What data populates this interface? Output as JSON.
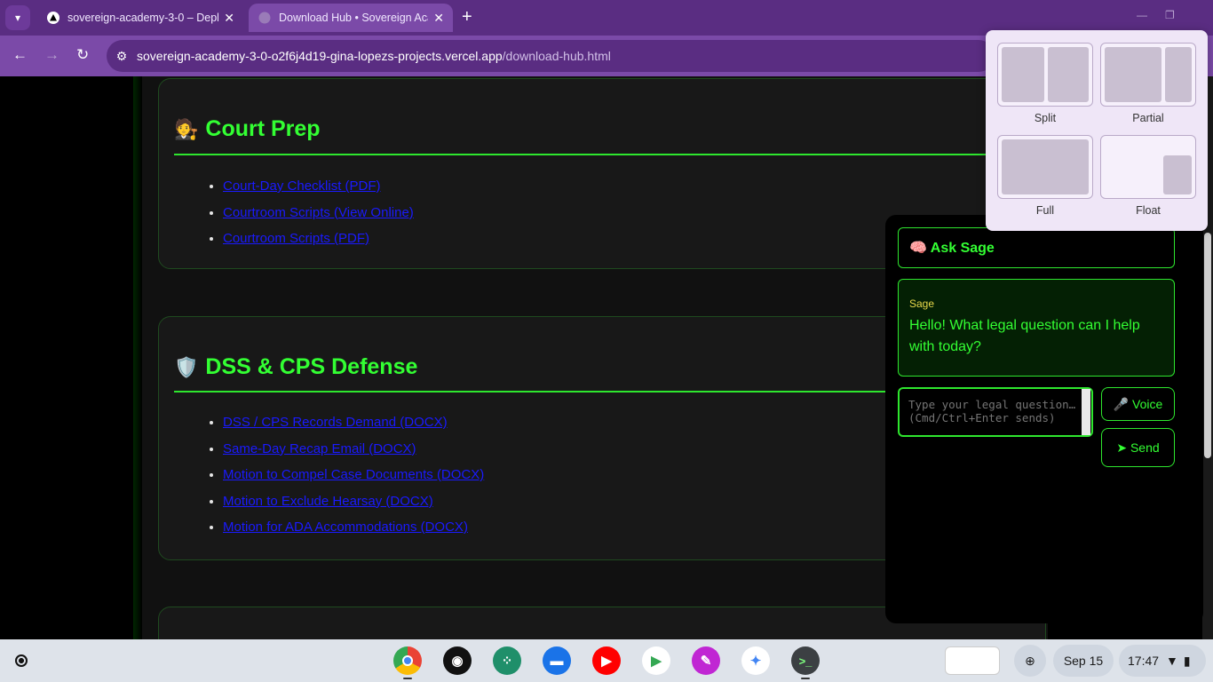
{
  "browser": {
    "tabs": [
      {
        "title": "sovereign-academy-3-0 – Deplo",
        "favicon": "vercel-icon"
      },
      {
        "title": "Download Hub • Sovereign Aca",
        "favicon": "globe-icon"
      }
    ],
    "url_host": "sovereign-academy-3-0-o2f6j4d19-gina-lopezs-projects.vercel.app",
    "url_path": "/download-hub.html"
  },
  "sections": [
    {
      "emoji": "🧑‍⚖️",
      "title": "Court Prep",
      "links": [
        "Court-Day Checklist (PDF)",
        "Courtroom Scripts (View Online)",
        "Courtroom Scripts (PDF)"
      ]
    },
    {
      "emoji": "🛡️",
      "title": "DSS & CPS Defense",
      "links": [
        "DSS / CPS Records Demand (DOCX)",
        "Same-Day Recap Email (DOCX)",
        "Motion to Compel Case Documents (DOCX)",
        "Motion to Exclude Hearsay (DOCX)",
        "Motion for ADA Accommodations (DOCX)"
      ]
    }
  ],
  "sage": {
    "title": "🧠 Ask Sage",
    "sender": "Sage",
    "message": "Hello! What legal question can I help with today?",
    "input_placeholder": "Type your legal question… (Cmd/Ctrl+Enter sends)",
    "voice_label": "🎤 Voice",
    "send_label": "➤ Send"
  },
  "snap_layout": {
    "options": [
      "Split",
      "Partial",
      "Full",
      "Float"
    ]
  },
  "shelf": {
    "apps": [
      {
        "name": "chrome-icon",
        "color": "#ea4335"
      },
      {
        "name": "podcast-icon",
        "color": "#111111"
      },
      {
        "name": "apps-grid-icon",
        "color": "#1f8f6a"
      },
      {
        "name": "messages-icon",
        "color": "#1a73e8"
      },
      {
        "name": "youtube-icon",
        "color": "#ff0000"
      },
      {
        "name": "play-store-icon",
        "color": "#34a853"
      },
      {
        "name": "canvas-icon",
        "color": "#c026d3"
      },
      {
        "name": "gemini-icon",
        "color": "#4285f4"
      },
      {
        "name": "terminal-icon",
        "color": "#3c4043"
      }
    ],
    "date": "Sep 15",
    "time": "17:47"
  }
}
